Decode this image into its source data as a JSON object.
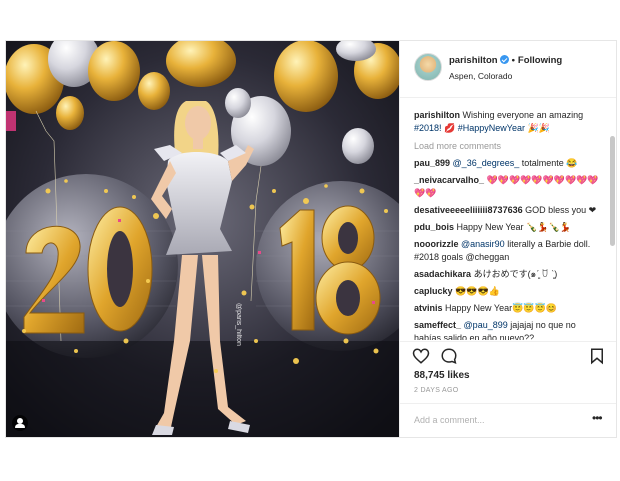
{
  "photo": {
    "year_text": "2018",
    "watermark": "@paris_hilton",
    "colors": {
      "gold": "#e8b23a",
      "silver": "#e9e9ee",
      "background": "#1a1a22"
    }
  },
  "header": {
    "username": "parishilton",
    "separator": "•",
    "follow_label": "Following",
    "location": "Aspen, Colorado"
  },
  "caption": {
    "username": "parishilton",
    "text": "Wishing everyone an amazing",
    "hashtag1": "#2018!",
    "emoji1": "💋",
    "hashtag2": "#HappyNewYear",
    "emoji2": "🎉🎉"
  },
  "load_more": "Load more comments",
  "comments": [
    {
      "user": "pau_899",
      "mention": "@_36_degrees_",
      "text": "totalmente 😂"
    },
    {
      "user": "_neivacarvalho_",
      "mention": "",
      "text": "💖💖💖💖💖💖💖💖💖💖💖💖"
    },
    {
      "user": "desativeeeeeliiiiii8737636",
      "mention": "",
      "text": "GOD bless you ❤"
    },
    {
      "user": "pdu_bois",
      "mention": "",
      "text": "Happy New Year 🍾💃🍾💃"
    },
    {
      "user": "nooorizzle",
      "mention": "@anasir90",
      "text": "literally a Barbie doll. #2018 goals @cheggan"
    },
    {
      "user": "asadachikara",
      "mention": "",
      "text": "あけおめです(๑ˊ͈ ꇴ ˋ͈)"
    },
    {
      "user": "caplucky",
      "mention": "",
      "text": "😎😎😎👍"
    },
    {
      "user": "atvinis",
      "mention": "",
      "text": "Happy New Year😇😇😇😊"
    },
    {
      "user": "sameffect_",
      "mention": "@pau_899",
      "text": "jajajaj no que no habías salido en año nuevo??"
    }
  ],
  "likes": "88,745 likes",
  "timestamp": "2 DAYS AGO",
  "add_comment_placeholder": "Add a comment...",
  "more_options": "•••",
  "icons": [
    "heart-icon",
    "comment-icon",
    "bookmark-icon",
    "verified-badge-icon",
    "user-tag-icon"
  ],
  "accent_color": "#3897f0"
}
